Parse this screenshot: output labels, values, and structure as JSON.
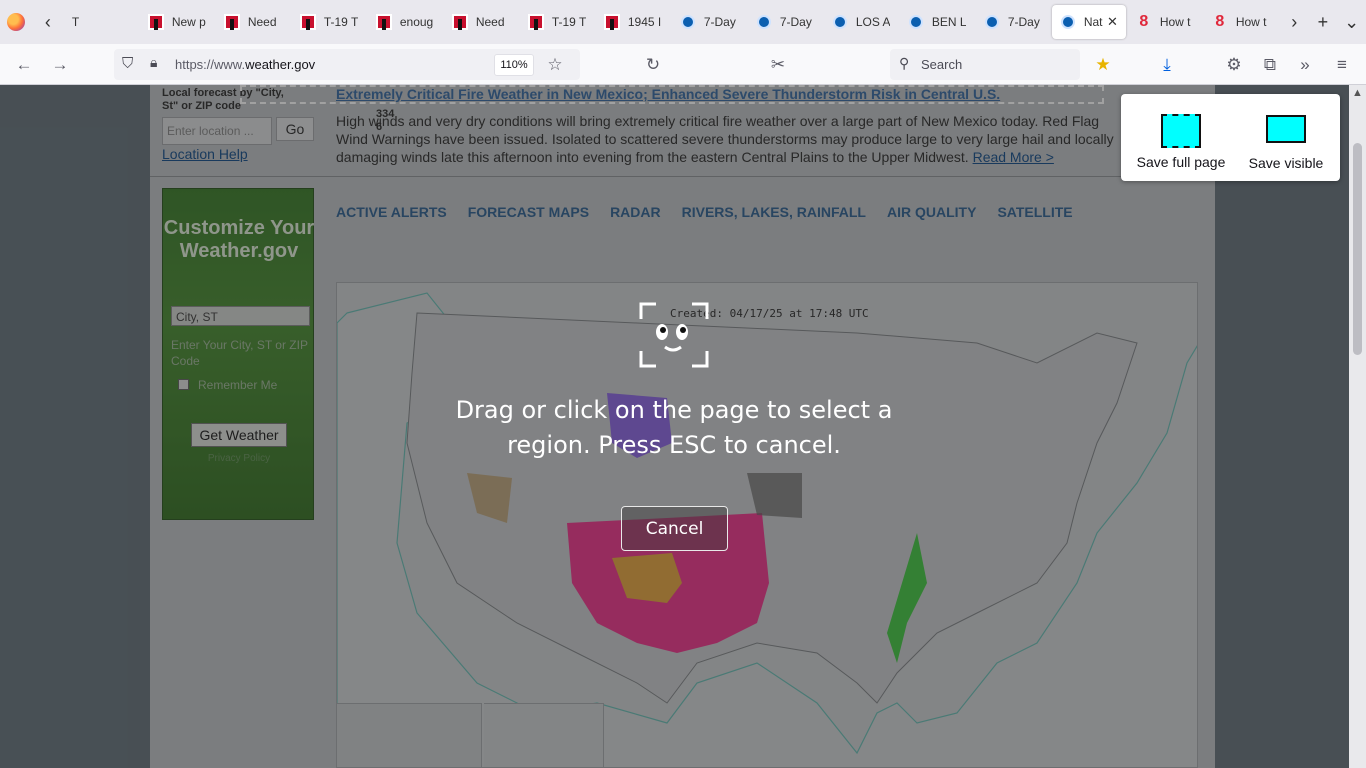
{
  "browser": {
    "tabs": [
      {
        "label": "T",
        "favicon": "firefox-view-icon"
      },
      {
        "label": "New p",
        "favicon": "ih-logo-icon"
      },
      {
        "label": "Need",
        "favicon": "ih-logo-icon"
      },
      {
        "label": "T-19 T",
        "favicon": "ih-logo-icon"
      },
      {
        "label": "enoug",
        "favicon": "ih-logo-icon"
      },
      {
        "label": "Need",
        "favicon": "ih-logo-icon"
      },
      {
        "label": "T-19 T",
        "favicon": "ih-logo-icon"
      },
      {
        "label": "1945 I",
        "favicon": "ih-logo-icon"
      },
      {
        "label": "7-Day",
        "favicon": "nws-logo-icon"
      },
      {
        "label": "7-Day",
        "favicon": "nws-logo-icon"
      },
      {
        "label": "LOS A",
        "favicon": "nws-logo-icon"
      },
      {
        "label": "BEN L",
        "favicon": "nws-logo-icon"
      },
      {
        "label": "7-Day",
        "favicon": "nws-logo-icon"
      },
      {
        "label": "Nat",
        "favicon": "nws-logo-icon",
        "active": true
      },
      {
        "label": "How t",
        "favicon": "eight-logo-icon"
      },
      {
        "label": "How t",
        "favicon": "eight-logo-icon"
      }
    ],
    "url_prefix": "https://www.",
    "url_domain": "weather.gov",
    "zoom": "110%",
    "search_placeholder": "Search"
  },
  "page": {
    "local_forecast_label": "Local forecast by \"City, St\" or ZIP code",
    "location_placeholder": "Enter location ...",
    "go_label": "Go",
    "location_help": "Location Help",
    "headline": "Extremely Critical Fire Weather in New Mexico; Enhanced Severe Thunderstorm Risk in Central U.S.",
    "selection_size": "334\n6",
    "alert_text": "High winds and very dry conditions will bring extremely critical fire weather over a large part of New Mexico today. Red Flag Wind Warnings have been issued. Isolated to scattered severe thunderstorms may produce large to very large hail and locally damaging winds late this afternoon into evening from the eastern Central Plains to the Upper Midwest.",
    "read_more": "Read More >",
    "customize": {
      "title": "Customize Your Weather.gov",
      "city_value": "City, ST",
      "hint": "Enter Your City, ST or ZIP Code",
      "remember": "Remember Me",
      "button": "Get Weather",
      "privacy": "Privacy Policy"
    },
    "nav_tabs": [
      "ACTIVE ALERTS",
      "FORECAST MAPS",
      "RADAR",
      "RIVERS, LAKES, RAINFALL",
      "AIR QUALITY",
      "SATELLITE"
    ],
    "map_created": "Created: 04/17/25 at 17:48 UTC"
  },
  "screenshot_tool": {
    "message": "Drag or click on the page to select a region. Press ESC to cancel.",
    "cancel": "Cancel",
    "save_full": "Save full page",
    "save_visible": "Save visible"
  },
  "colors": {
    "red_flag": "#d8106f",
    "fire_weather": "#c9a227",
    "wind": "#6a3fd0",
    "flood": "#20b020",
    "overlay_tint": "#323232"
  }
}
